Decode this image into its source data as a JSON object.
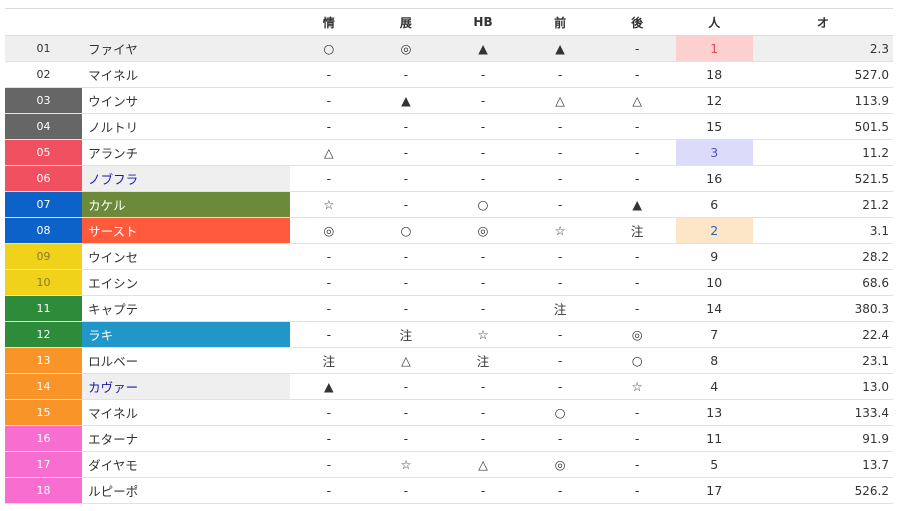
{
  "headers": [
    "",
    "",
    "情",
    "展",
    "HB",
    "前",
    "後",
    "人",
    "オ"
  ],
  "rows": [
    {
      "num": "01",
      "name": "ファイヤ",
      "m1": "○",
      "m2": "◎",
      "m3": "▲",
      "m4": "▲",
      "m5": "-",
      "ninki": "1",
      "odds": "2.3",
      "numbg": "#efefef",
      "numfg": "#333333",
      "namebg": "",
      "namefg": "#333333",
      "ninkibg": "#fdd0d0",
      "ninkifg": "#e05050",
      "rowbg": "#efefef"
    },
    {
      "num": "02",
      "name": "マイネル",
      "m1": "-",
      "m2": "-",
      "m3": "-",
      "m4": "-",
      "m5": "-",
      "ninki": "18",
      "odds": "527.0",
      "numbg": "#ffffff",
      "numfg": "#333333",
      "namebg": "",
      "namefg": "#333333",
      "ninkibg": "",
      "ninkifg": "#333333",
      "rowbg": ""
    },
    {
      "num": "03",
      "name": "ウインサ",
      "m1": "-",
      "m2": "▲",
      "m3": "-",
      "m4": "△",
      "m5": "△",
      "ninki": "12",
      "odds": "113.9",
      "numbg": "#666666",
      "numfg": "#ffffff",
      "namebg": "",
      "namefg": "#333333",
      "ninkibg": "",
      "ninkifg": "#333333",
      "rowbg": ""
    },
    {
      "num": "04",
      "name": "ノルトリ",
      "m1": "-",
      "m2": "-",
      "m3": "-",
      "m4": "-",
      "m5": "-",
      "ninki": "15",
      "odds": "501.5",
      "numbg": "#666666",
      "numfg": "#ffffff",
      "namebg": "",
      "namefg": "#333333",
      "ninkibg": "",
      "ninkifg": "#333333",
      "rowbg": ""
    },
    {
      "num": "05",
      "name": "アランチ",
      "m1": "△",
      "m2": "-",
      "m3": "-",
      "m4": "-",
      "m5": "-",
      "ninki": "3",
      "odds": "11.2",
      "numbg": "#f05060",
      "numfg": "#ffffff",
      "namebg": "",
      "namefg": "#333333",
      "ninkibg": "#dcdcfa",
      "ninkifg": "#5050c0",
      "rowbg": ""
    },
    {
      "num": "06",
      "name": "ノブフラ",
      "m1": "-",
      "m2": "-",
      "m3": "-",
      "m4": "-",
      "m5": "-",
      "ninki": "16",
      "odds": "521.5",
      "numbg": "#f05060",
      "numfg": "#ffffff",
      "namebg": "#efefef",
      "namefg": "#1a1aa6",
      "ninkibg": "",
      "ninkifg": "#333333",
      "rowbg": ""
    },
    {
      "num": "07",
      "name": "カケル",
      "m1": "☆",
      "m2": "-",
      "m3": "○",
      "m4": "-",
      "m5": "▲",
      "ninki": "6",
      "odds": "21.2",
      "numbg": "#0c62c8",
      "numfg": "#ffffff",
      "namebg": "#6b8a3a",
      "namefg": "#ffffff",
      "ninkibg": "",
      "ninkifg": "#333333",
      "rowbg": ""
    },
    {
      "num": "08",
      "name": "サースト",
      "m1": "◎",
      "m2": "○",
      "m3": "◎",
      "m4": "☆",
      "m5": "注",
      "ninki": "2",
      "odds": "3.1",
      "numbg": "#0c62c8",
      "numfg": "#ffffff",
      "namebg": "#ff5a3c",
      "namefg": "#ffffff",
      "ninkibg": "#fde6c8",
      "ninkifg": "#3060c0",
      "rowbg": ""
    },
    {
      "num": "09",
      "name": "ウインセ",
      "m1": "-",
      "m2": "-",
      "m3": "-",
      "m4": "-",
      "m5": "-",
      "ninki": "9",
      "odds": "28.2",
      "numbg": "#f0d21a",
      "numfg": "#8a7a30",
      "namebg": "",
      "namefg": "#333333",
      "ninkibg": "",
      "ninkifg": "#333333",
      "rowbg": ""
    },
    {
      "num": "10",
      "name": "エイシン",
      "m1": "-",
      "m2": "-",
      "m3": "-",
      "m4": "-",
      "m5": "-",
      "ninki": "10",
      "odds": "68.6",
      "numbg": "#f0d21a",
      "numfg": "#8a7a30",
      "namebg": "",
      "namefg": "#333333",
      "ninkibg": "",
      "ninkifg": "#333333",
      "rowbg": ""
    },
    {
      "num": "11",
      "name": "キャプテ",
      "m1": "-",
      "m2": "-",
      "m3": "-",
      "m4": "注",
      "m5": "-",
      "ninki": "14",
      "odds": "380.3",
      "numbg": "#2e8b3a",
      "numfg": "#ffffff",
      "namebg": "",
      "namefg": "#333333",
      "ninkibg": "",
      "ninkifg": "#333333",
      "rowbg": ""
    },
    {
      "num": "12",
      "name": "ラキ",
      "m1": "-",
      "m2": "注",
      "m3": "☆",
      "m4": "-",
      "m5": "◎",
      "ninki": "7",
      "odds": "22.4",
      "numbg": "#2e8b3a",
      "numfg": "#ffffff",
      "namebg": "#2196c8",
      "namefg": "#ffffff",
      "ninkibg": "",
      "ninkifg": "#333333",
      "rowbg": ""
    },
    {
      "num": "13",
      "name": "ロルベー",
      "m1": "注",
      "m2": "△",
      "m3": "注",
      "m4": "-",
      "m5": "○",
      "ninki": "8",
      "odds": "23.1",
      "numbg": "#f89428",
      "numfg": "#ffffff",
      "namebg": "",
      "namefg": "#333333",
      "ninkibg": "",
      "ninkifg": "#333333",
      "rowbg": ""
    },
    {
      "num": "14",
      "name": "カヴァー",
      "m1": "▲",
      "m2": "-",
      "m3": "-",
      "m4": "-",
      "m5": "☆",
      "ninki": "4",
      "odds": "13.0",
      "numbg": "#f89428",
      "numfg": "#ffffff",
      "namebg": "#efefef",
      "namefg": "#1a1aa6",
      "ninkibg": "",
      "ninkifg": "#333333",
      "rowbg": ""
    },
    {
      "num": "15",
      "name": "マイネル",
      "m1": "-",
      "m2": "-",
      "m3": "-",
      "m4": "○",
      "m5": "-",
      "ninki": "13",
      "odds": "133.4",
      "numbg": "#f89428",
      "numfg": "#ffffff",
      "namebg": "",
      "namefg": "#333333",
      "ninkibg": "",
      "ninkifg": "#333333",
      "rowbg": ""
    },
    {
      "num": "16",
      "name": "エターナ",
      "m1": "-",
      "m2": "-",
      "m3": "-",
      "m4": "-",
      "m5": "-",
      "ninki": "11",
      "odds": "91.9",
      "numbg": "#f86ed0",
      "numfg": "#ffffff",
      "namebg": "",
      "namefg": "#333333",
      "ninkibg": "",
      "ninkifg": "#333333",
      "rowbg": ""
    },
    {
      "num": "17",
      "name": "ダイヤモ",
      "m1": "-",
      "m2": "☆",
      "m3": "△",
      "m4": "◎",
      "m5": "-",
      "ninki": "5",
      "odds": "13.7",
      "numbg": "#f86ed0",
      "numfg": "#ffffff",
      "namebg": "",
      "namefg": "#333333",
      "ninkibg": "",
      "ninkifg": "#333333",
      "rowbg": ""
    },
    {
      "num": "18",
      "name": "ルピーポ",
      "m1": "-",
      "m2": "-",
      "m3": "-",
      "m4": "-",
      "m5": "-",
      "ninki": "17",
      "odds": "526.2",
      "numbg": "#f86ed0",
      "numfg": "#ffffff",
      "namebg": "",
      "namefg": "#333333",
      "ninkibg": "",
      "ninkifg": "#333333",
      "rowbg": ""
    }
  ]
}
